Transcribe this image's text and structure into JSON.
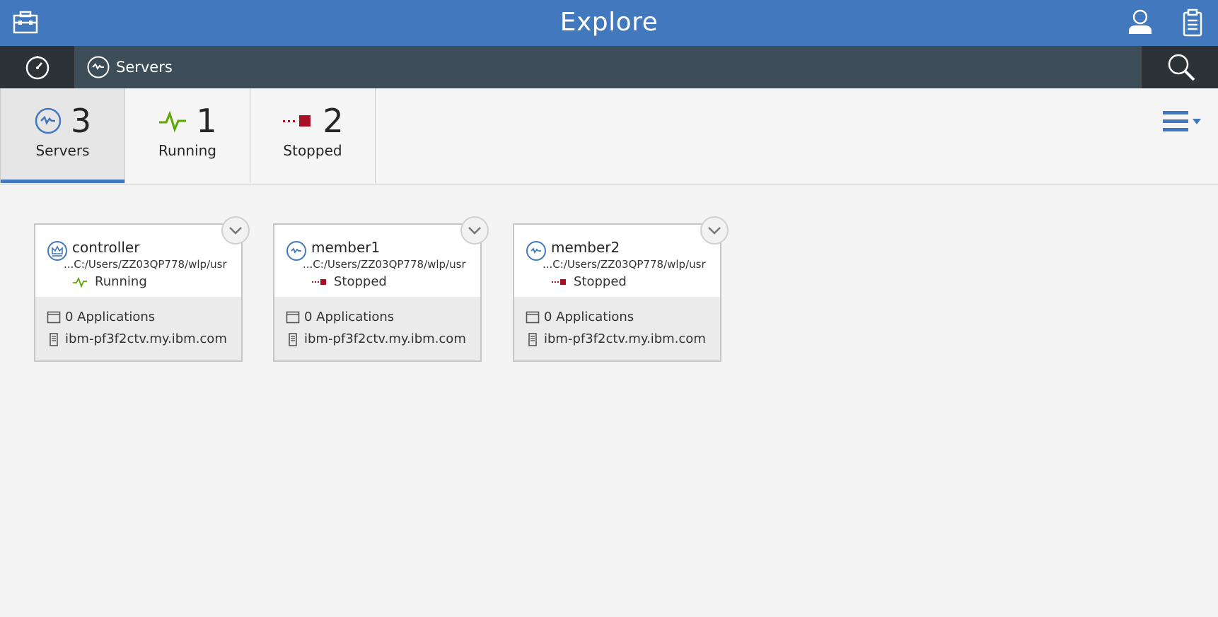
{
  "header": {
    "title": "Explore",
    "icons": [
      "toolbox-icon",
      "user-icon",
      "clipboard-icon"
    ]
  },
  "subnav": {
    "breadcrumb_label": "Servers",
    "icons": [
      "dashboard-icon",
      "server-icon",
      "search-icon"
    ]
  },
  "summary": {
    "tiles": [
      {
        "count": "3",
        "label": "Servers",
        "icon": "server-icon",
        "active": true
      },
      {
        "count": "1",
        "label": "Running",
        "icon": "running-pulse-icon",
        "active": false
      },
      {
        "count": "2",
        "label": "Stopped",
        "icon": "stopped-icon",
        "active": false
      }
    ]
  },
  "cards": [
    {
      "name": "controller",
      "path": "...C:/Users/ZZ03QP778/wlp/usr",
      "status": "Running",
      "applications": "0 Applications",
      "host": "ibm-pf3f2ctv.my.ibm.com",
      "icon": "controller-crown-icon"
    },
    {
      "name": "member1",
      "path": "...C:/Users/ZZ03QP778/wlp/usr",
      "status": "Stopped",
      "applications": "0 Applications",
      "host": "ibm-pf3f2ctv.my.ibm.com",
      "icon": "server-icon"
    },
    {
      "name": "member2",
      "path": "...C:/Users/ZZ03QP778/wlp/usr",
      "status": "Stopped",
      "applications": "0 Applications",
      "host": "ibm-pf3f2ctv.my.ibm.com",
      "icon": "server-icon"
    }
  ],
  "colors": {
    "header_bg": "#4178be",
    "subnav_bg": "#3d4e58",
    "running": "#5aa700",
    "stopped": "#a91024"
  }
}
